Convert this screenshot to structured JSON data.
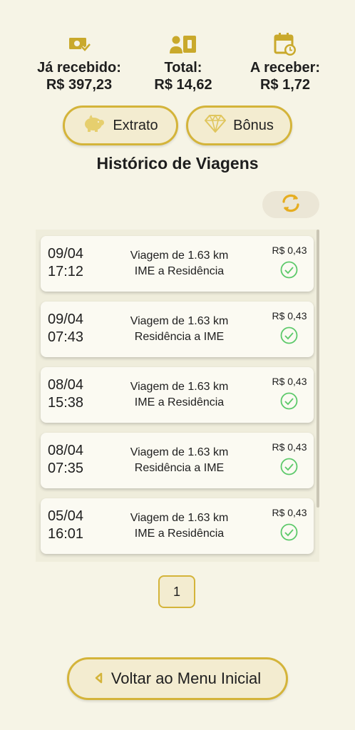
{
  "summary": {
    "received": {
      "label": "Já recebido:",
      "value": "R$ 397,23",
      "icon": "money-check-icon"
    },
    "total": {
      "label": "Total:",
      "value": "R$ 14,62",
      "icon": "user-money-icon"
    },
    "to_receive": {
      "label": "A receber:",
      "value": "R$ 1,72",
      "icon": "calendar-clock-icon"
    }
  },
  "buttons": {
    "extrato": "Extrato",
    "bonus": "Bônus"
  },
  "title": "Histórico de Viagens",
  "trips": [
    {
      "date": "09/04",
      "time": "17:12",
      "line1": "Viagem de 1.63 km",
      "line2": "IME a Residência",
      "price": "R$ 0,43"
    },
    {
      "date": "09/04",
      "time": "07:43",
      "line1": "Viagem de 1.63 km",
      "line2": "Residência a IME",
      "price": "R$ 0,43"
    },
    {
      "date": "08/04",
      "time": "15:38",
      "line1": "Viagem de 1.63 km",
      "line2": "IME a Residência",
      "price": "R$ 0,43"
    },
    {
      "date": "08/04",
      "time": "07:35",
      "line1": "Viagem de 1.63 km",
      "line2": "Residência a IME",
      "price": "R$ 0,43"
    },
    {
      "date": "05/04",
      "time": "16:01",
      "line1": "Viagem de 1.63 km",
      "line2": "IME a Residência",
      "price": "R$ 0,43"
    }
  ],
  "pagination": {
    "current": "1"
  },
  "back_button": "Voltar ao Menu Inicial",
  "colors": {
    "accent": "#d4b43a",
    "check": "#5cc96a",
    "background": "#f6f4e6"
  }
}
